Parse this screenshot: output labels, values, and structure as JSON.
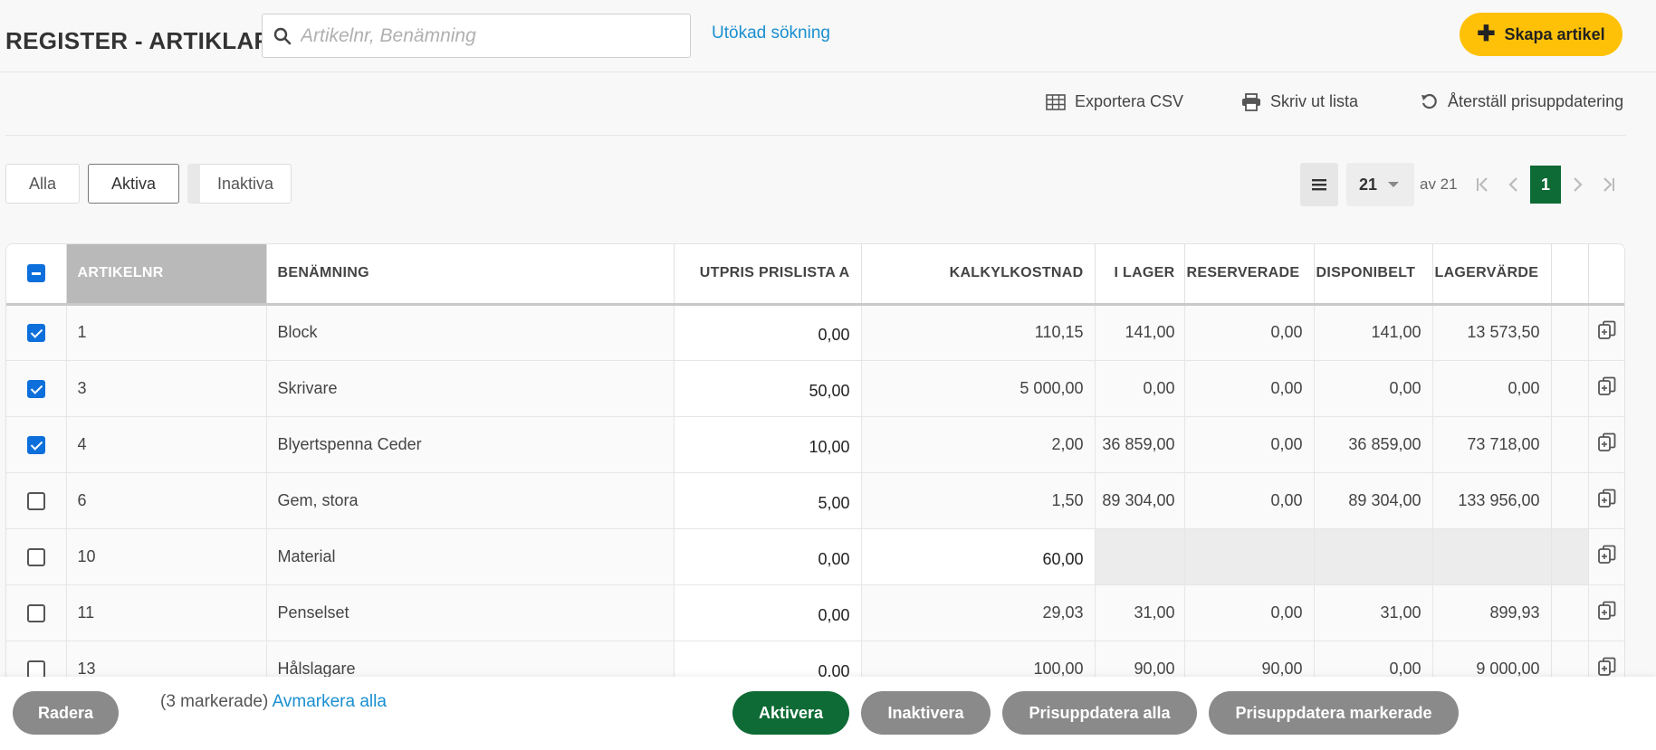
{
  "header": {
    "title": "REGISTER - ARTIKLAR",
    "search_placeholder": "Artikelnr, Benämning",
    "extended_search": "Utökad sökning",
    "create_button": "Skapa artikel"
  },
  "toolbar": {
    "export_csv": "Exportera CSV",
    "print_list": "Skriv ut lista",
    "reset_price_update": "Återställ prisuppdatering"
  },
  "filters": [
    "Alla",
    "Aktiva",
    "Inaktiva"
  ],
  "active_filter": "Aktiva",
  "pagination": {
    "page_size": "21",
    "total_text": "av 21",
    "current_page": "1"
  },
  "table": {
    "columns": [
      "ARTIKELNR",
      "BENÄMNING",
      "UTPRIS PRISLISTA A",
      "KALKYLKOSTNAD",
      "I LAGER",
      "RESERVERADE",
      "DISPONIBELT",
      "LAGERVÄRDE"
    ],
    "rows": [
      {
        "checked": true,
        "artikelnr": "1",
        "benamning": "Block",
        "utpris": "0,00",
        "kalkyl": "110,15",
        "ilager": "141,00",
        "reserverade": "0,00",
        "disponibelt": "141,00",
        "lagervarde": "13 573,50"
      },
      {
        "checked": true,
        "artikelnr": "3",
        "benamning": "Skrivare",
        "utpris": "50,00",
        "kalkyl": "5 000,00",
        "ilager": "0,00",
        "reserverade": "0,00",
        "disponibelt": "0,00",
        "lagervarde": "0,00"
      },
      {
        "checked": true,
        "artikelnr": "4",
        "benamning": "Blyertspenna Ceder",
        "utpris": "10,00",
        "kalkyl": "2,00",
        "ilager": "36 859,00",
        "reserverade": "0,00",
        "disponibelt": "36 859,00",
        "lagervarde": "73 718,00"
      },
      {
        "checked": false,
        "artikelnr": "6",
        "benamning": "Gem, stora",
        "utpris": "5,00",
        "kalkyl": "1,50",
        "ilager": "89 304,00",
        "reserverade": "0,00",
        "disponibelt": "89 304,00",
        "lagervarde": "133 956,00"
      },
      {
        "checked": false,
        "artikelnr": "10",
        "benamning": "Material",
        "utpris": "0,00",
        "kalkyl": "60,00",
        "ilager": null,
        "reserverade": null,
        "disponibelt": null,
        "lagervarde": null
      },
      {
        "checked": false,
        "artikelnr": "11",
        "benamning": "Penselset",
        "utpris": "0,00",
        "kalkyl": "29,03",
        "ilager": "31,00",
        "reserverade": "0,00",
        "disponibelt": "31,00",
        "lagervarde": "899,93"
      },
      {
        "checked": false,
        "artikelnr": "13",
        "benamning": "Hålslagare",
        "utpris": "0,00",
        "kalkyl": "100,00",
        "ilager": "90,00",
        "reserverade": "90,00",
        "disponibelt": "0,00",
        "lagervarde": "9 000,00"
      }
    ]
  },
  "footer": {
    "delete": "Radera",
    "selected_count": "(3 markerade)",
    "deselect_all": "Avmarkera alla",
    "activate": "Aktivera",
    "deactivate": "Inaktivera",
    "price_update_all": "Prisuppdatera alla",
    "price_update_selected": "Prisuppdatera markerade"
  },
  "colors": {
    "accent_yellow": "#ffc107",
    "primary_green": "#0e6b35",
    "link_blue": "#1a8fd0",
    "checkbox_blue": "#0d6fdb"
  }
}
